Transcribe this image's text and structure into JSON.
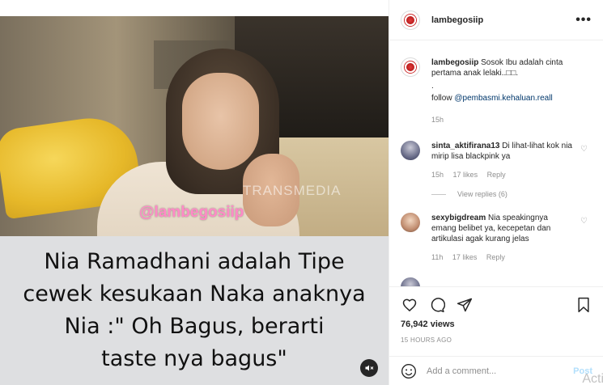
{
  "post": {
    "username": "lambegosiip",
    "more_icon": "more-horizontal-icon",
    "overlay_tag": "@lambegosiip",
    "video_watermark": "TRANSMEDIA",
    "caption_lines": [
      "Nia Ramadhani adalah Tipe",
      "cewek kesukaan Naka anaknya",
      "Nia :\" Oh Bagus, berarti",
      "taste nya bagus\""
    ],
    "mute_icon": "volume-mute-icon"
  },
  "caption_comment": {
    "username": "lambegosiip",
    "text": "Sosok Ibu adalah cinta pertama anak lelaki..□□.",
    "dot": ".",
    "follow_prefix": "follow ",
    "follow_link": "@pembasmi.kehaluan.reall",
    "time": "15h"
  },
  "comments": [
    {
      "username": "sinta_aktifirana13",
      "text": "Di lihat-lihat kok nia mirip lisa blackpink ya",
      "time": "15h",
      "likes": "17 likes",
      "reply": "Reply",
      "view_replies": "View replies (6)"
    },
    {
      "username": "sexybigdream",
      "text": "Nia speakingnya emang belibet ya, kecepetan dan artikulasi agak kurang jelas",
      "time": "11h",
      "likes": "17 likes",
      "reply": "Reply"
    }
  ],
  "actions": {
    "icons": [
      "heart-icon",
      "comment-icon",
      "share-icon",
      "bookmark-icon"
    ],
    "views": "76,942 views",
    "time_ago": "15 HOURS AGO"
  },
  "add_comment": {
    "placeholder": "Add a comment...",
    "post_label": "Post",
    "watermark": "Activ"
  },
  "colors": {
    "link": "#00376b",
    "muted": "#8e8e8e",
    "post_disabled": "#b2dffc",
    "overlay_tag": "#ff8ac7"
  }
}
